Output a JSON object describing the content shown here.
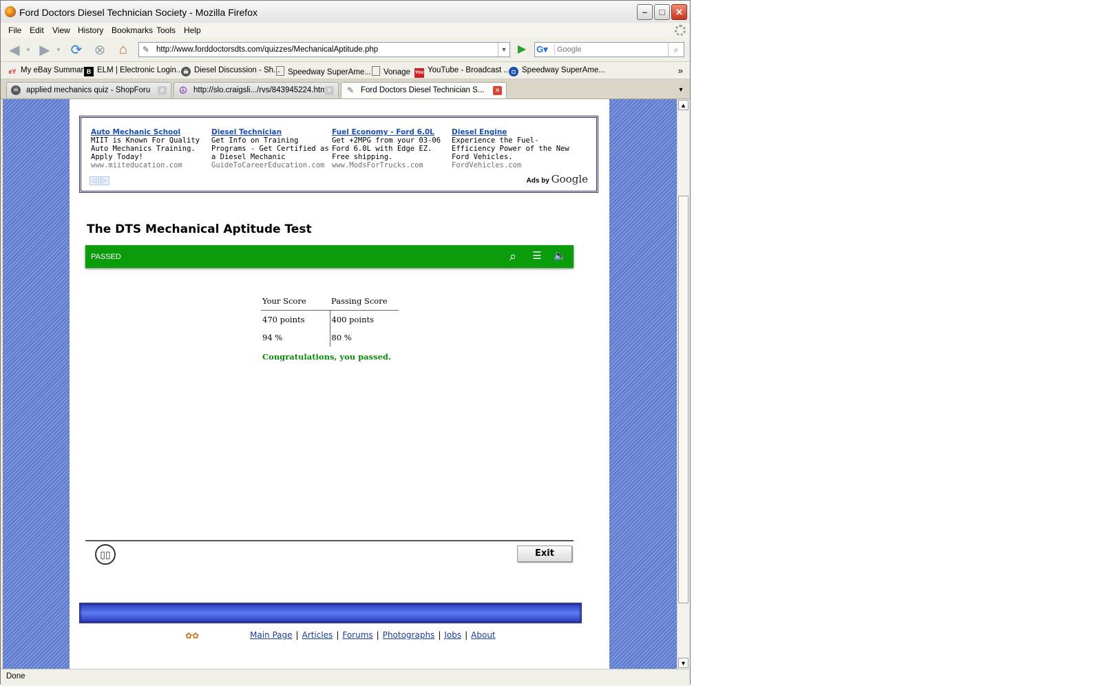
{
  "window": {
    "title": "Ford Doctors Diesel Technician Society - Mozilla Firefox"
  },
  "menu": [
    "File",
    "Edit",
    "View",
    "History",
    "Bookmarks",
    "Tools",
    "Help"
  ],
  "nav": {
    "url": "http://www.forddoctorsdts.com/quizzes/MechanicalAptitude.php",
    "search_placeholder": "Google"
  },
  "bookmarks": [
    {
      "label": "My eBay Summary",
      "icon": "ebay-icon"
    },
    {
      "label": "ELM | Electronic Login...",
      "icon": "b-logo-icon"
    },
    {
      "label": "Diesel Discussion - Sh...",
      "icon": "skull-icon"
    },
    {
      "label": "Speedway SuperAme...",
      "icon": "page-icon"
    },
    {
      "label": "Vonage",
      "icon": "page-icon"
    },
    {
      "label": "YouTube - Broadcast ...",
      "icon": "youtube-icon"
    },
    {
      "label": "Speedway SuperAme...",
      "icon": "chase-icon"
    }
  ],
  "tabs": [
    {
      "label": "applied mechanics quiz - ShopForum",
      "icon": "skull-icon"
    },
    {
      "label": "http://slo.craigsli.../rvs/843945224.html",
      "icon": "peace-icon"
    },
    {
      "label": "Ford Doctors Diesel Technician S...",
      "icon": "wrench-icon"
    }
  ],
  "ads": [
    {
      "title": "Auto Mechanic School",
      "desc": "MIIT is Known For Quality Auto Mechanics Training. Apply Today!",
      "url": "www.miiteducation.com"
    },
    {
      "title": "Diesel Technician",
      "desc": "Get Info on Training Programs - Get Certified as a Diesel Mechanic",
      "url": "GuideToCareerEducation.com"
    },
    {
      "title": "Fuel Economy - Ford 6.0L",
      "desc": "Get +2MPG from your 03-06 Ford 6.0L with Edge EZ. Free shipping.",
      "url": "www.ModsForTrucks.com"
    },
    {
      "title": "Diesel Engine",
      "desc": "Experience the Fuel-Efficiency Power of the New Ford Vehicles.",
      "url": "FordVehicles.com"
    }
  ],
  "ads_by": {
    "prefix": "Ads by",
    "brand": "Google"
  },
  "quiz": {
    "title": "The DTS Mechanical Aptitude Test",
    "status": "PASSED",
    "headers": [
      "Your Score",
      "Passing Score"
    ],
    "rows": [
      [
        "470 points",
        "400 points"
      ],
      [
        "94 %",
        "80 %"
      ]
    ],
    "message": "Congratulations, you passed.",
    "exit_label": "Exit"
  },
  "footer_links": [
    "Main Page",
    "Articles",
    "Forums",
    "Photographs",
    "Jobs",
    "About"
  ],
  "status": "Done"
}
